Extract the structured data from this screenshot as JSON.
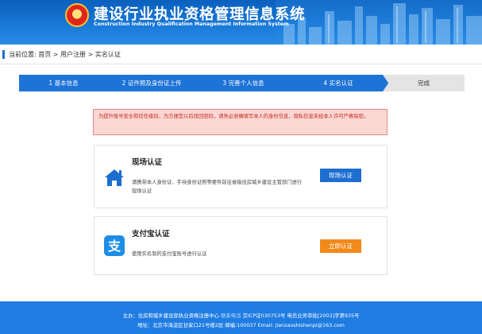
{
  "header": {
    "title_cn": "建设行业执业资格管理信息系统",
    "title_en": "Construction Industry Qualification Management Information System"
  },
  "breadcrumb": {
    "prefix": "当前位置:",
    "items": [
      "首页",
      "用户注册",
      "实名认证"
    ],
    "sep": " > "
  },
  "steps": [
    {
      "label": "1 基本信息"
    },
    {
      "label": "2 证件照及身份证上传"
    },
    {
      "label": "3 完善个人信息"
    },
    {
      "label": "4 实名认证"
    },
    {
      "label": "完成"
    }
  ],
  "notice": "为提升账号安全和信任级别，为方便您以后找回密码，请务必准确填写本人的身份信息，隐私信息未经本人许可严格保密。",
  "onsite": {
    "title": "现场认证",
    "desc": "请携带本人身份证、手持身份证照等要件前往省级住房城乡建设主管部门进行现场认证",
    "button": "现场认证"
  },
  "alipay": {
    "title": "支付宝认证",
    "desc": "使用实名制的支付宝账号进行认证",
    "button": "立即认证"
  },
  "footer": {
    "host": "主办：住房和城乡建设部执业资格注册中心",
    "contact": "联系电话",
    "icp": "京ICP证030753号",
    "telecom": "电信业务审批[2003]字第935号",
    "address": "地址：北京市海淀区甘家口21号楼2层",
    "zip": "邮编:100037",
    "email": "Email: jianzaoshishenpi@163.com"
  },
  "colors": {
    "primary": "#1e73d6",
    "notice_bg": "#fbd7d4",
    "notice_text": "#c6291f",
    "orange": "#f28a1a"
  },
  "icons": {
    "onsite": "home-icon",
    "alipay": "alipay-icon",
    "emblem": "national-emblem-icon"
  }
}
